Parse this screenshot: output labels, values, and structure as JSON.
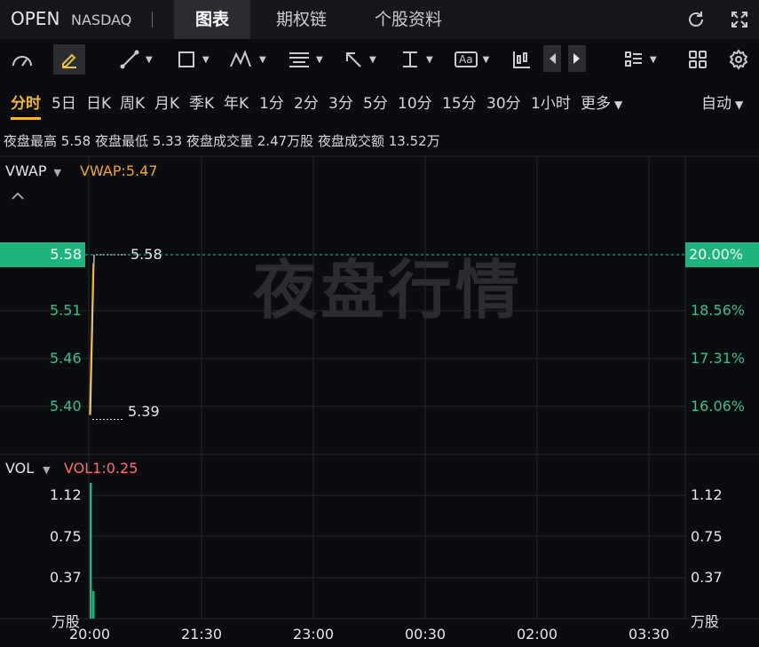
{
  "header": {
    "symbol": "OPEN",
    "exchange": "NASDAQ",
    "tabs": [
      {
        "label": "图表",
        "active": true
      },
      {
        "label": "期权链",
        "active": false
      },
      {
        "label": "个股资料",
        "active": false
      }
    ],
    "icons": [
      "refresh-icon",
      "fullscreen-icon"
    ]
  },
  "toolbar": {
    "tools": [
      "indicator-gauge-icon",
      "draw-pencil-icon",
      "line-tool-icon",
      "rectangle-tool-icon",
      "wave-tool-icon",
      "text-lines-tool-icon",
      "arrow-tool-icon",
      "measure-tool-icon",
      "text-label-tool-icon",
      "candlestick-type-icon",
      "prev-arrow-icon",
      "next-arrow-icon",
      "list-layout-icon",
      "grid-layout-icon",
      "settings-icon"
    ],
    "text_label_tool": "Aa"
  },
  "periods": {
    "items": [
      "分时",
      "5日",
      "日K",
      "周K",
      "月K",
      "季K",
      "年K",
      "1分",
      "2分",
      "3分",
      "5分",
      "10分",
      "15分",
      "30分",
      "1小时",
      "更多"
    ],
    "active": "分时",
    "more_caret": "▼",
    "auto": "自动",
    "auto_caret": "▼"
  },
  "stats": {
    "high_label": "夜盘最高",
    "high": "5.58",
    "low_label": "夜盘最低",
    "low": "5.33",
    "vol_label": "夜盘成交量",
    "vol": "2.47万股",
    "amount_label": "夜盘成交额",
    "amount": "13.52万"
  },
  "price_chart": {
    "indicator": "VWAP",
    "indicator_caret": "▼",
    "indicator_value": "VWAP:5.47",
    "collapse_icon": "chevron-up-icon",
    "watermark": "夜盘行情",
    "y_labels_left": [
      "5.51",
      "5.46",
      "5.40"
    ],
    "y_labels_right": [
      "18.56%",
      "17.31%",
      "16.06%"
    ],
    "current_price": "5.58",
    "current_pct": "20.00%",
    "max_marker": "5.58",
    "min_marker": "5.39",
    "price_color": "#e6e6e6",
    "vwap_color": "#f5a623",
    "up_color": "#1fb37d"
  },
  "volume_chart": {
    "indicator": "VOL",
    "indicator_caret": "▼",
    "indicator_value": "VOL1:0.25",
    "value_color": "#ff6b6b",
    "y_labels_left": [
      "1.12",
      "0.75",
      "0.37",
      "万股"
    ],
    "y_labels_right": [
      "1.12",
      "0.75",
      "0.37",
      "万股"
    ]
  },
  "x_axis": [
    "20:00",
    "21:30",
    "23:00",
    "00:30",
    "02:00",
    "03:30"
  ],
  "chart_data": {
    "type": "line",
    "x_label": "",
    "y_label": "",
    "series": [
      {
        "values": [
          5.39,
          5.58
        ]
      },
      {
        "name": "VWAP",
        "values": [
          5.39,
          5.47
        ]
      }
    ],
    "volume": [
      1.12,
      0.25
    ],
    "y_range": [
      5.33,
      5.58
    ],
    "grid": true
  }
}
